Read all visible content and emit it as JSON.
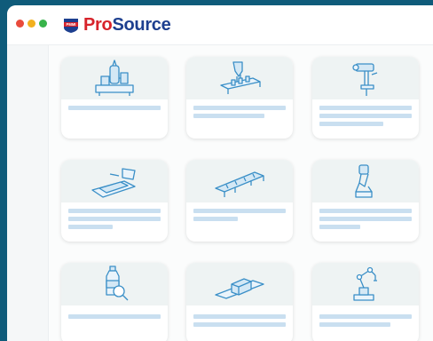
{
  "window": {
    "controls": [
      "close",
      "minimize",
      "maximize"
    ],
    "colors": {
      "close": "#e94b3c",
      "minimize": "#f2b01e",
      "maximize": "#37b34a"
    }
  },
  "brand": {
    "badge_text": "PMMI",
    "name_accent": "Pro",
    "name_rest": "Source",
    "colors": {
      "primary": "#1d3f8f",
      "accent": "#d7232b"
    }
  },
  "cards": [
    {
      "icon": "processing-plant-icon"
    },
    {
      "icon": "filling-machine-icon"
    },
    {
      "icon": "inspection-camera-icon"
    },
    {
      "icon": "tray-conveyor-icon"
    },
    {
      "icon": "belt-conveyor-icon"
    },
    {
      "icon": "robotic-gripper-icon"
    },
    {
      "icon": "bottle-inspection-icon"
    },
    {
      "icon": "wrapping-machine-icon"
    },
    {
      "icon": "robot-arm-icon"
    }
  ],
  "colors": {
    "background": "#0f5b7a",
    "card_image": "#eef3f3",
    "placeholder_line": "#c9dff0",
    "illustration": "#3a8fc7"
  }
}
